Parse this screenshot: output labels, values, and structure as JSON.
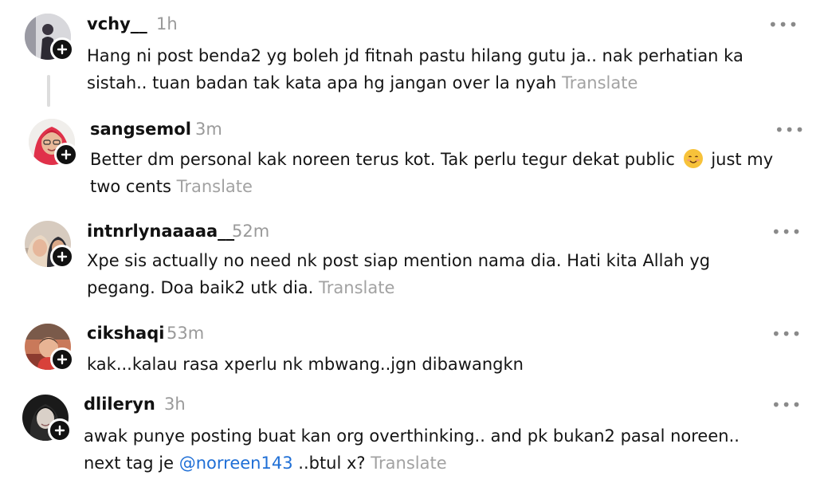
{
  "comments": [
    {
      "username": "vchy__",
      "time": "1h",
      "line1": "Hang ni post benda2 yg boleh jd fitnah pastu hilang gutu ja.. nak perhatian ka",
      "line2": "sistah.. tuan badan tak kata apa hg jangan over la nyah",
      "translate": "Translate"
    },
    {
      "username": "sangsemol",
      "time": "3m",
      "line1a": "Better dm personal kak noreen terus kot. Tak perlu tegur dekat public",
      "emoji": "smiling-face-emoji",
      "line1b": "just my",
      "line2": "two cents",
      "translate": "Translate"
    },
    {
      "username": "intnrlynaaaaa__",
      "time": "52m",
      "line1": "Xpe sis actually no need nk post siap mention nama dia. Hati kita Allah yg",
      "line2": "pegang. Doa baik2 utk dia.",
      "translate": "Translate"
    },
    {
      "username": "cikshaqi",
      "time": "53m",
      "line1": "kak...kalau rasa xperlu nk mbwang..jgn dibawangkn"
    },
    {
      "username": "dlileryn",
      "time": "3h",
      "line1": "awak punye posting buat kan org overthinking.. and pk bukan2 pasal noreen..",
      "line2a": "next tag je",
      "mention": "@norreen143",
      "line2b": "..btul x?",
      "translate": "Translate"
    }
  ],
  "more_label": "•••",
  "icons": {
    "plus": "follow-plus-icon",
    "more": "more-options-icon"
  },
  "colors": {
    "mention": "#1f6fd6",
    "translate": "#a2a2a2",
    "time": "#9a9a9a"
  }
}
